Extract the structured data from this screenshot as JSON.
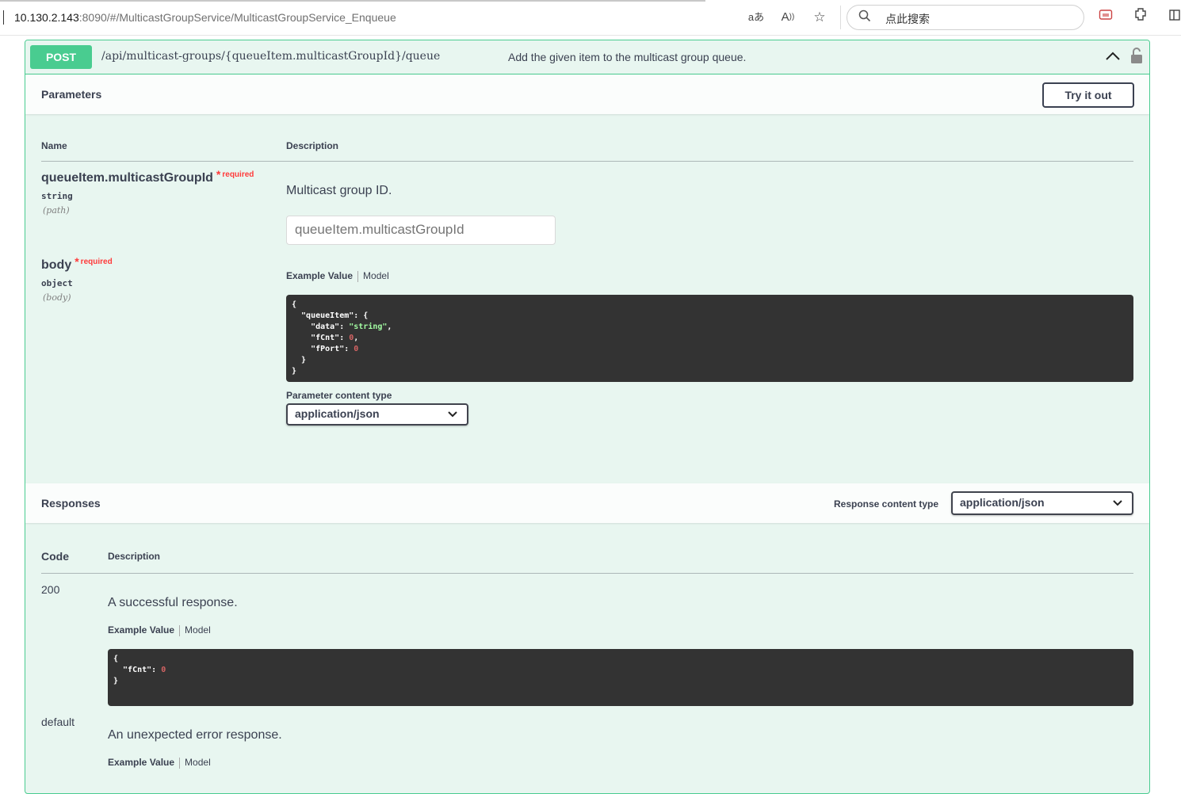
{
  "browser": {
    "url_host": "10.130.2.143",
    "url_rest": ":8090/#/MulticastGroupService/MulticastGroupService_Enqueue",
    "search_placeholder": "点此搜索",
    "icons": [
      "read-aloud-icon",
      "text-size-icon",
      "favorite-star-icon",
      "search-icon",
      "screenshot-icon",
      "extensions-icon",
      "split-view-icon"
    ]
  },
  "operation": {
    "method": "POST",
    "path": "/api/multicast-groups/{queueItem.multicastGroupId}/queue",
    "summary": "Add the given item to the multicast group queue."
  },
  "parameters": {
    "title": "Parameters",
    "try_label": "Try it out",
    "col_name": "Name",
    "col_description": "Description",
    "items": [
      {
        "name": "queueItem.multicastGroupId",
        "required_star": "*",
        "required_label": "required",
        "type": "string",
        "in": "(path)",
        "description": "Multicast group ID.",
        "placeholder": "queueItem.multicastGroupId"
      },
      {
        "name": "body",
        "required_star": "*",
        "required_label": "required",
        "type": "object",
        "in": "(body)",
        "tab_example": "Example Value",
        "tab_model": "Model",
        "example": {
          "l1": "{",
          "l2_key": "  \"queueItem\": {",
          "l3_key": "    \"data\": ",
          "l3_val": "\"string\"",
          "l3_end": ",",
          "l4_key": "    \"fCnt\": ",
          "l4_val": "0",
          "l4_end": ",",
          "l5_key": "    \"fPort\": ",
          "l5_val": "0",
          "l6": "  }",
          "l7": "}"
        },
        "content_type_label": "Parameter content type",
        "content_type_value": "application/json"
      }
    ]
  },
  "responses": {
    "title": "Responses",
    "content_type_label": "Response content type",
    "content_type_value": "application/json",
    "col_code": "Code",
    "col_description": "Description",
    "items": [
      {
        "code": "200",
        "description": "A successful response.",
        "tab_example": "Example Value",
        "tab_model": "Model",
        "example": {
          "l1": "{",
          "l2_key": "  \"fCnt\": ",
          "l2_val": "0",
          "l3": "}"
        }
      },
      {
        "code": "default",
        "description": "An unexpected error response.",
        "tab_example": "Example Value",
        "tab_model": "Model"
      }
    ]
  },
  "colors": {
    "post": "#49cc90",
    "post_bg": "#e8f6f0",
    "code_bg": "#333333",
    "required": "#ff3a3a"
  }
}
